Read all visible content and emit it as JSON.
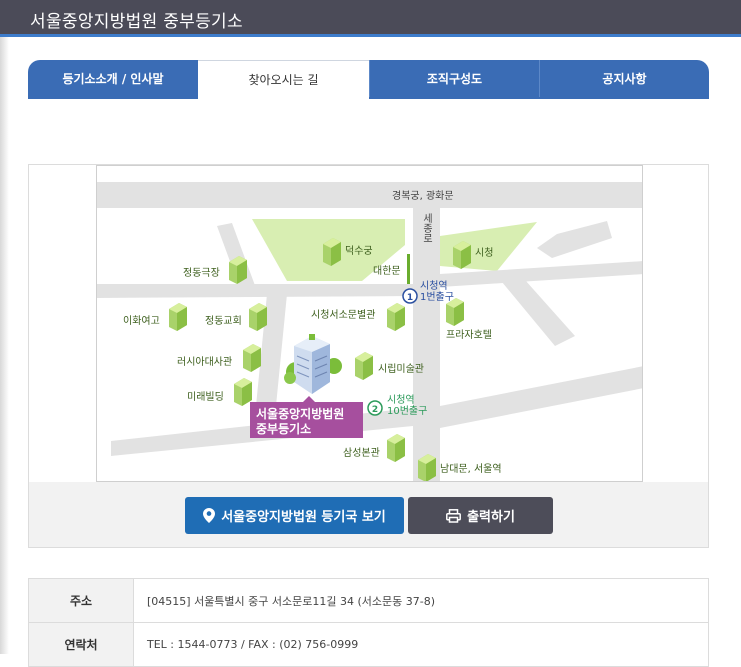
{
  "header": {
    "title": "서울중앙지방법원  중부등기소"
  },
  "tabs": [
    {
      "label": "등기소소개 / 인사말"
    },
    {
      "label": "찾아오시는 길"
    },
    {
      "label": "조직구성도"
    },
    {
      "label": "공지사항"
    }
  ],
  "map": {
    "road_top": "경복궁, 광화문",
    "road_vertical": "세종로",
    "landmarks": {
      "deoksugung": "덕수궁",
      "daehanmun": "대한문",
      "cityhall": "시청",
      "jeongdong_theater": "정동극장",
      "ewha": "이화여고",
      "jeongdong_church": "정동교회",
      "fire_annex": "시청서소문별관",
      "plaza_hotel": "프라자호텔",
      "russia_embassy": "러시아대사관",
      "art_museum": "시립미술관",
      "mirae_bldg": "미래빌딩",
      "samsung": "삼성본관",
      "namdaemun": "남대문, 서울역"
    },
    "station1": {
      "num": "1",
      "line1": "시청역",
      "line2": "1번출구"
    },
    "station2": {
      "num": "2",
      "line1": "시청역",
      "line2": "10번출구"
    },
    "destination": {
      "line1": "서울중앙지방법원",
      "line2": "중부등기소"
    }
  },
  "buttons": {
    "view_label": "서울중앙지방법원 등기국 보기",
    "print_label": "출력하기"
  },
  "info": {
    "address_label": "주소",
    "address_value": "[04515] 서울특별시 중구 서소문로11길 34 (서소문동 37-8)",
    "contact_label": "연락처",
    "contact_value": "TEL : 1544-0773 / FAX : (02) 756-0999"
  },
  "colors": {
    "tab_blue": "#3a6cb5",
    "header_bg": "#4b4b58",
    "button_blue": "#1f6db5",
    "button_dark": "#4d4d59",
    "marker_purple": "#a64f9e"
  }
}
